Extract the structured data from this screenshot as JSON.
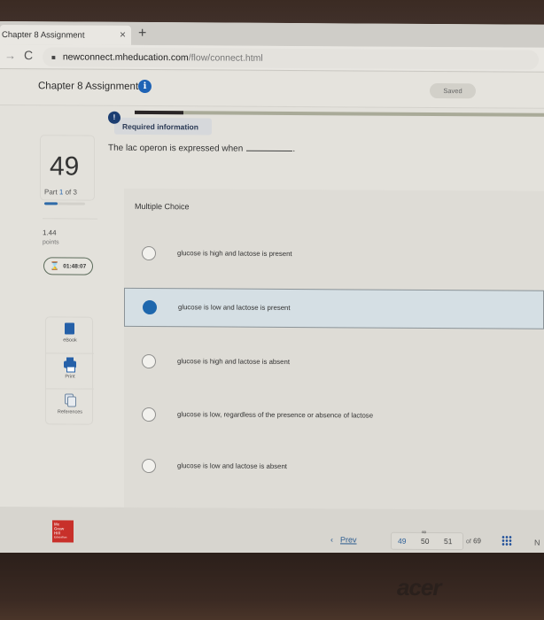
{
  "browser": {
    "tab_title": "Chapter 8 Assignment",
    "tab_close": "×",
    "new_tab": "+",
    "nav_forward": "→",
    "nav_reload": "C",
    "lock_icon": "🔒",
    "url_host": "newconnect.mheducation.com",
    "url_path": "/flow/connect.html"
  },
  "header": {
    "assignment_title": "Chapter 8 Assignment",
    "info_icon": "i",
    "saved_label": "Saved",
    "overall_progress": 0.12
  },
  "question": {
    "number": "49",
    "required_badge_icon": "!",
    "required_label": "Required information",
    "prompt": "The lac operon is expressed when",
    "prompt_end": "."
  },
  "part": {
    "label_prefix": "Part",
    "current": "1",
    "label_of": "of 3",
    "progress": 0.33
  },
  "points": {
    "value": "1.44",
    "label": "points"
  },
  "timer": {
    "icon": "⌛",
    "value": "01:48:07"
  },
  "tools": [
    {
      "label": "eBook",
      "icon": "ebook-icon"
    },
    {
      "label": "Print",
      "icon": "print-icon"
    },
    {
      "label": "References",
      "icon": "references-icon"
    }
  ],
  "answer": {
    "type_label": "Multiple Choice",
    "options": [
      {
        "text": "glucose is high and lactose is present",
        "selected": false
      },
      {
        "text": "glucose is low and lactose is present",
        "selected": true
      },
      {
        "text": "glucose is high and lactose is absent",
        "selected": false
      },
      {
        "text": "glucose is low, regardless of the presence or absence of lactose",
        "selected": false
      },
      {
        "text": "glucose is low and lactose is absent",
        "selected": false
      }
    ]
  },
  "footer": {
    "logo_lines": [
      "Mc",
      "Graw",
      "Hill",
      "Education"
    ],
    "prev_arrow": "‹",
    "prev_label": "Prev",
    "pages": [
      "49",
      "50",
      "51"
    ],
    "current_page": "49",
    "link_icon": "∞",
    "of_label": "of",
    "total": "69",
    "next_partial": "N"
  },
  "device": {
    "brand": "acer"
  },
  "colors": {
    "accent_blue": "#1e67ad",
    "required_badge": "#1c3e72",
    "logo_red": "#c8302a"
  }
}
